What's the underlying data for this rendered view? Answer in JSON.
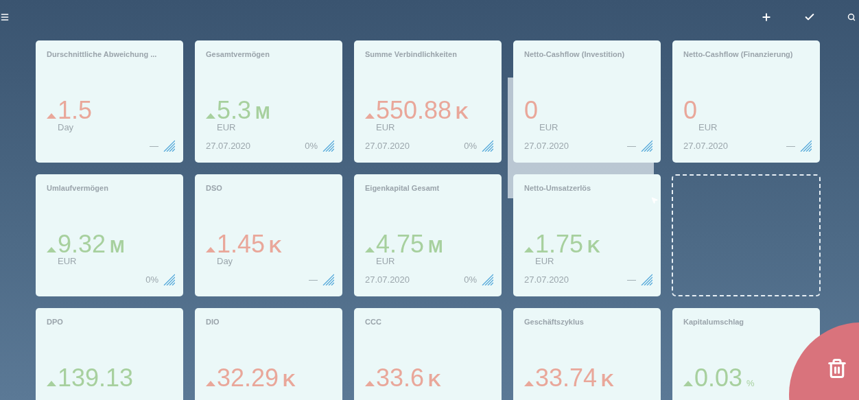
{
  "tiles": [
    {
      "kind": "tile",
      "title": "Durschnittliche Abweichung ...",
      "trend_up": true,
      "color": "#e9a79a",
      "value": "1.5",
      "unit": "Day",
      "delta": "—"
    },
    {
      "kind": "tile",
      "title": "Gesamtvermögen",
      "trend_up": true,
      "color": "#a7d09e",
      "value": "5.3",
      "scale": "M",
      "unit": "EUR",
      "date": "27.07.2020",
      "delta": "0%"
    },
    {
      "kind": "tile",
      "title": "Summe Verbindlichkeiten",
      "trend_up": true,
      "color": "#e9a79a",
      "value": "550.88",
      "scale": "K",
      "unit": "EUR",
      "date": "27.07.2020",
      "delta": "0%"
    },
    {
      "kind": "tile",
      "title": "Netto-Cashflow (Investition)",
      "trend_up": false,
      "color": "#e9a79a",
      "value": "0",
      "unit": "EUR",
      "date": "27.07.2020",
      "delta": "—"
    },
    {
      "kind": "tile",
      "title": "Netto-Cashflow (Finanzierung)",
      "trend_up": false,
      "color": "#e9a79a",
      "value": "0",
      "unit": "EUR",
      "date": "27.07.2020",
      "delta": "—"
    },
    {
      "kind": "tile",
      "title": "Umlaufvermögen",
      "trend_up": true,
      "color": "#a7d09e",
      "value": "9.32",
      "scale": "M",
      "unit": "EUR",
      "delta": "0%"
    },
    {
      "kind": "tile",
      "title": "DSO",
      "trend_up": true,
      "color": "#e9a79a",
      "value": "1.45",
      "scale": "K",
      "unit": "Day",
      "delta": "—"
    },
    {
      "kind": "tile",
      "title": "Eigenkapital Gesamt",
      "trend_up": true,
      "color": "#a7d09e",
      "value": "4.75",
      "scale": "M",
      "unit": "EUR",
      "date": "27.07.2020",
      "delta": "0%"
    },
    {
      "kind": "tile",
      "title": "Netto-Umsatzerlös",
      "trend_up": true,
      "color": "#a7d09e",
      "value": "1.75",
      "scale": "K",
      "unit": "EUR",
      "date": "27.07.2020",
      "delta": "—"
    },
    {
      "kind": "slot"
    },
    {
      "kind": "tile",
      "title": "DPO",
      "trend_up": true,
      "color": "#a7d09e",
      "value": "139.13"
    },
    {
      "kind": "tile",
      "title": "DIO",
      "trend_up": true,
      "color": "#e9a79a",
      "value": "32.29",
      "scale": "K"
    },
    {
      "kind": "tile",
      "title": "CCC",
      "trend_up": true,
      "color": "#e9a79a",
      "value": "33.6",
      "scale": "K"
    },
    {
      "kind": "tile",
      "title": "Geschäftszyklus",
      "trend_up": true,
      "color": "#e9a79a",
      "value": "33.74",
      "scale": "K"
    },
    {
      "kind": "tile",
      "title": "Kapitalumschlag",
      "trend_up": true,
      "color": "#a7d09e",
      "value": "0.03",
      "scale": "%"
    }
  ]
}
